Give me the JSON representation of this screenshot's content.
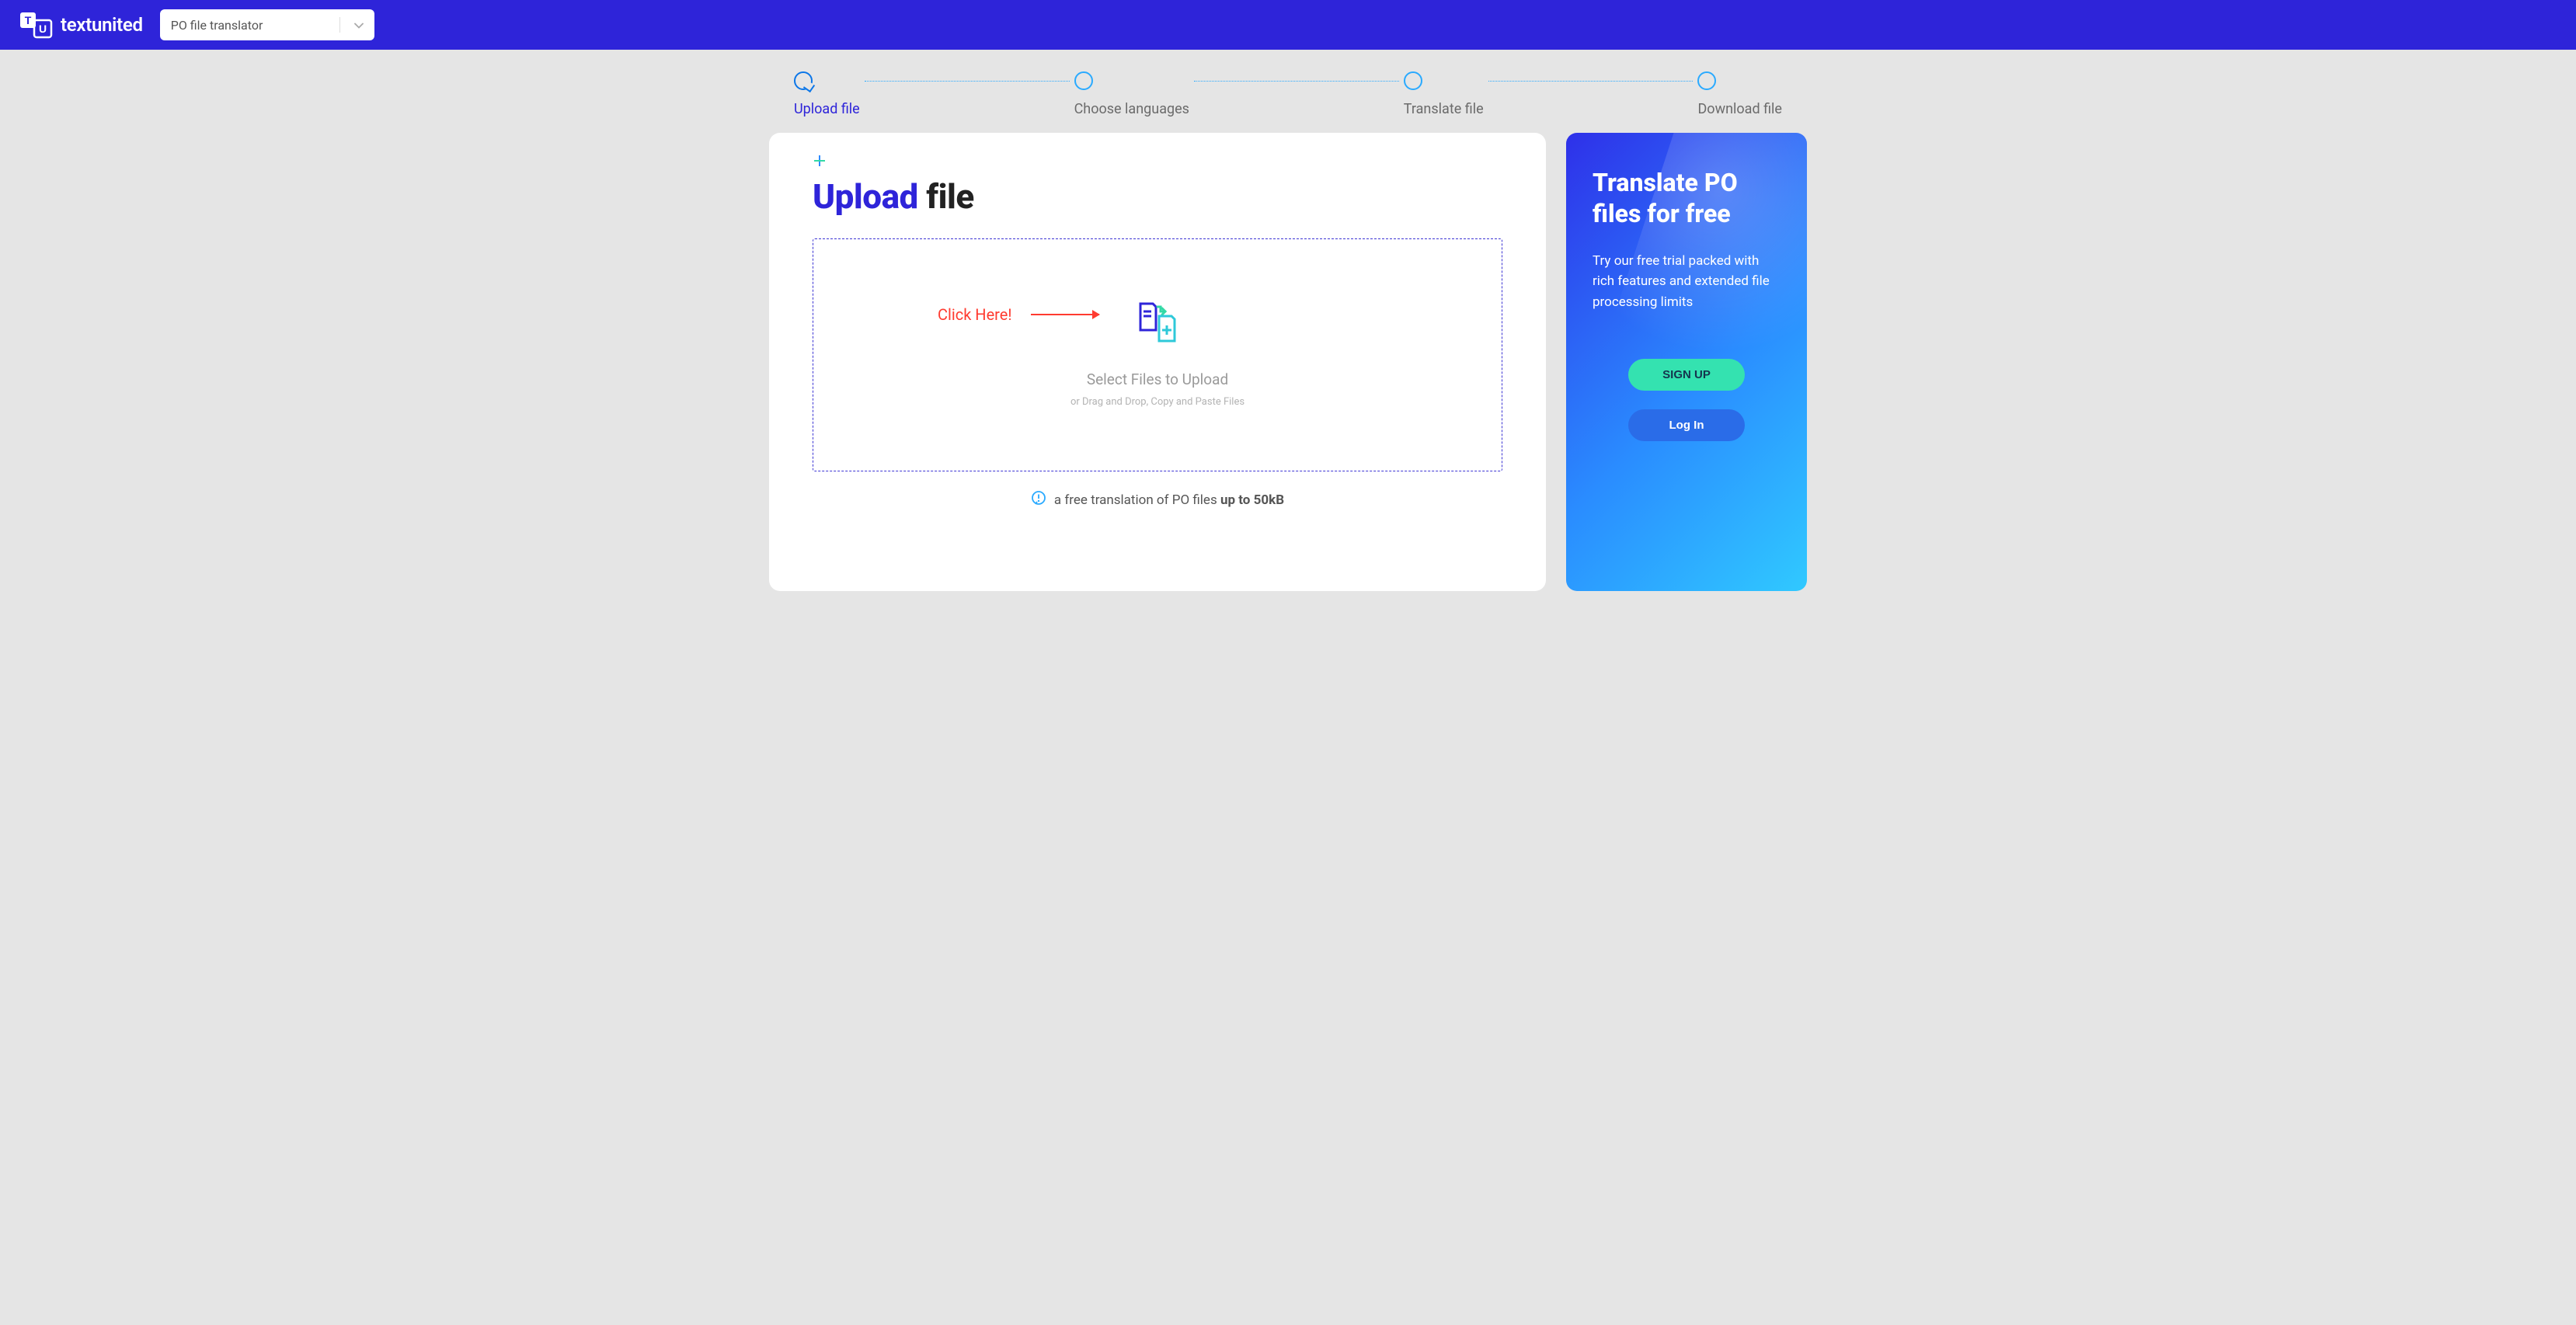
{
  "header": {
    "brand": "textunited",
    "selector_value": "PO file translator"
  },
  "progress": {
    "steps": [
      {
        "label": "Upload file"
      },
      {
        "label": "Choose languages"
      },
      {
        "label": "Translate file"
      },
      {
        "label": "Download file"
      }
    ]
  },
  "main": {
    "title_highlight": "Upload",
    "title_rest": " file",
    "click_here": "Click Here!",
    "dropzone": {
      "select_text": "Select Files to Upload",
      "sub_text": "or Drag and Drop, Copy and Paste Files"
    },
    "footnote_pre": "a free translation of PO files ",
    "footnote_strong": "up to 50kB"
  },
  "side": {
    "heading": "Translate PO files for free",
    "body": "Try our free trial packed with rich features and extended file processing limits",
    "signup_label": "SIGN UP",
    "login_label": "Log In"
  }
}
